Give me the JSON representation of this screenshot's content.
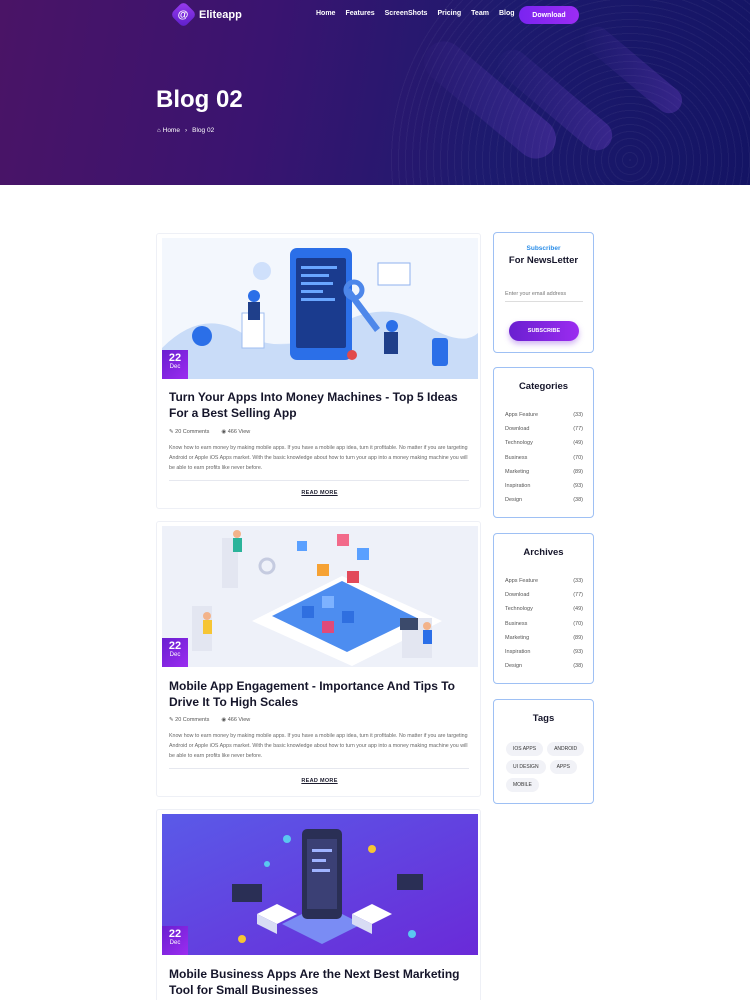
{
  "nav": {
    "logo_text": "Eliteapp",
    "items": [
      "Home",
      "Features",
      "ScreenShots",
      "Pricing",
      "Team",
      "Blog"
    ],
    "download_label": "Download"
  },
  "hero": {
    "title": "Blog 02",
    "breadcrumb_home": "Home",
    "breadcrumb_current": "Blog 02"
  },
  "posts": [
    {
      "day": "22",
      "month": "Dec",
      "title": "Turn Your Apps Into Money Machines - Top 5 Ideas For a Best Selling App",
      "comments": "20 Comments",
      "views": "466 View",
      "excerpt": "Know how to earn money by making mobile apps. If you have a mobile app idea, turn it profitable. No matter if you are targeting Android or Apple iOS Apps market. With the basic knowledge about how to turn your app into a money making machine you will be able to earn profits like never before.",
      "read_more": "READ MORE"
    },
    {
      "day": "22",
      "month": "Dec",
      "title": "Mobile App Engagement - Importance And Tips To Drive It To High Scales",
      "comments": "20 Comments",
      "views": "466 View",
      "excerpt": "Know how to earn money by making mobile apps. If you have a mobile app idea, turn it profitable. No matter if you are targeting Android or Apple iOS Apps market. With the basic knowledge about how to turn your app into a money making machine you will be able to earn profits like never before.",
      "read_more": "READ MORE"
    },
    {
      "day": "22",
      "month": "Dec",
      "title": "Mobile Business Apps Are the Next Best Marketing Tool for Small Businesses"
    }
  ],
  "newsletter": {
    "kicker": "Subscriber",
    "title": "For NewsLetter",
    "email_placeholder": "Enter your email address",
    "button": "SUBSCRIBE"
  },
  "categories": {
    "title": "Categories",
    "items": [
      {
        "name": "Apps Feature",
        "count": "(33)"
      },
      {
        "name": "Download",
        "count": "(77)"
      },
      {
        "name": "Technology",
        "count": "(49)"
      },
      {
        "name": "Business",
        "count": "(70)"
      },
      {
        "name": "Marketing",
        "count": "(89)"
      },
      {
        "name": "Inspiration",
        "count": "(93)"
      },
      {
        "name": "Design",
        "count": "(38)"
      }
    ]
  },
  "archives": {
    "title": "Archives",
    "items": [
      {
        "name": "Apps Feature",
        "count": "(33)"
      },
      {
        "name": "Download",
        "count": "(77)"
      },
      {
        "name": "Technology",
        "count": "(49)"
      },
      {
        "name": "Business",
        "count": "(70)"
      },
      {
        "name": "Marketing",
        "count": "(89)"
      },
      {
        "name": "Inspiration",
        "count": "(93)"
      },
      {
        "name": "Design",
        "count": "(38)"
      }
    ]
  },
  "tags": {
    "title": "Tags",
    "items": [
      "IOS APPS",
      "ANDROID",
      "UI DESIGN",
      "APPS",
      "MOBILE"
    ]
  },
  "icons": {
    "logo": "logo-icon",
    "home": "home-icon",
    "comments": "comment-icon",
    "views": "eye-icon"
  },
  "colors": {
    "accent": "#7a24f0",
    "hero_start": "#4a1466",
    "hero_end": "#141464",
    "link_blue": "#2a8de8",
    "box_border": "#9ec0f4"
  }
}
